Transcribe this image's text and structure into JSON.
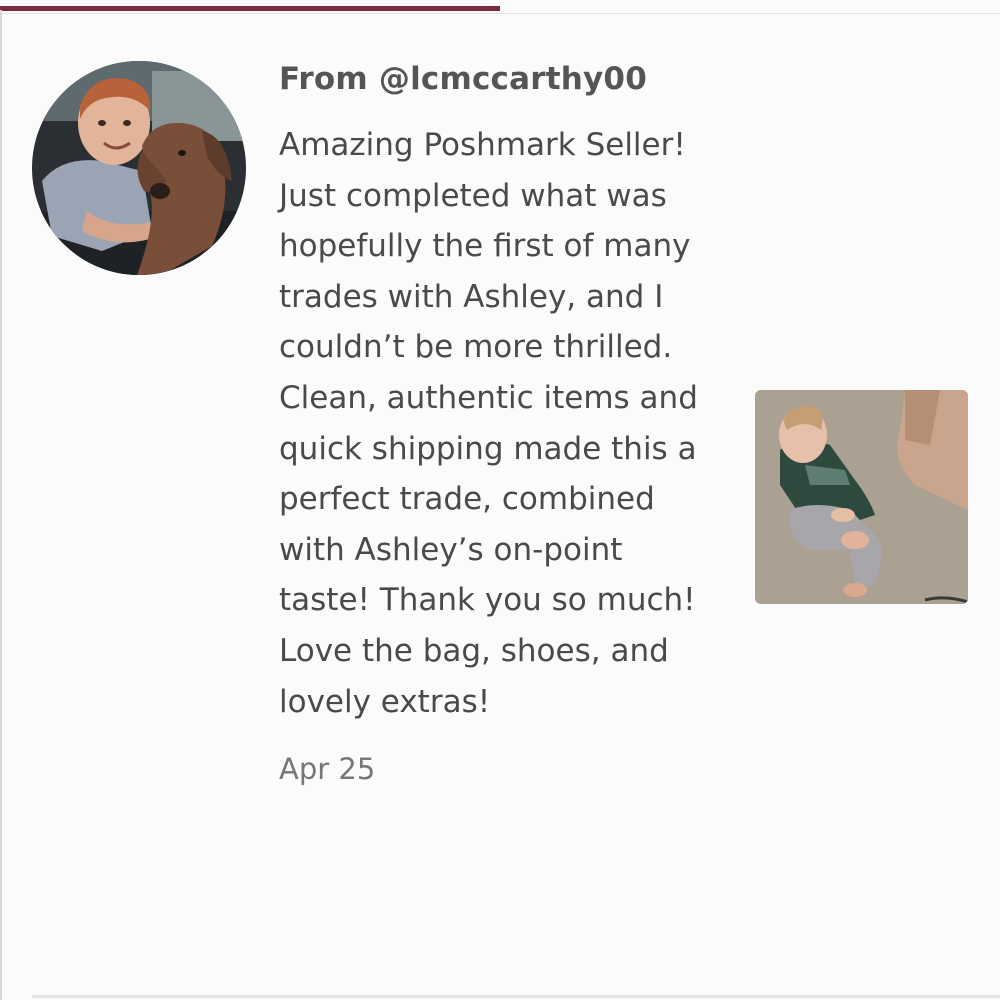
{
  "tabs": {
    "active_indicator_color": "#7a2a3d"
  },
  "review": {
    "author_label": "From @lcmccarthy00",
    "text": "Amazing Poshmark Seller! Just completed what was hopefully the first of many trades with Ashley, and I couldn’t be more thrilled. Clean, authentic items and quick shipping made this a perfect trade, combined with Ashley’s on-point taste! Thank you so much! Love the bag, shoes, and lovely extras!",
    "date": "Apr 25",
    "avatar_icon": "user-avatar-photo",
    "attachment_icon": "review-photo-thumbnail"
  }
}
